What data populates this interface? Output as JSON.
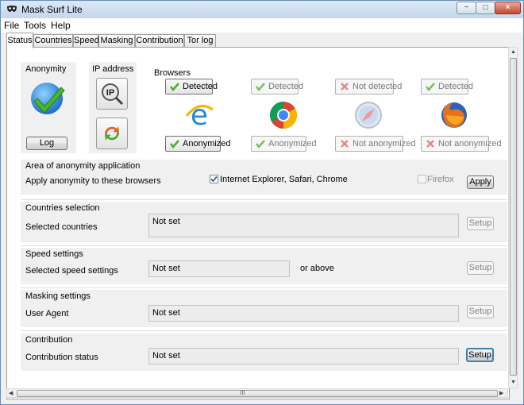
{
  "window": {
    "title": "Mask Surf Lite",
    "controls": {
      "minimize": "−",
      "maximize": "□",
      "close": "×"
    }
  },
  "menu": [
    "File",
    "Tools",
    "Help"
  ],
  "tabs": [
    "Status",
    "Countries",
    "Speed",
    "Masking",
    "Contribution",
    "Tor log"
  ],
  "active_tab": "Status",
  "status": {
    "anonymity": {
      "label": "Anonymity",
      "log_button": "Log",
      "icon": "check-globe-icon"
    },
    "ip": {
      "label": "IP address",
      "ip_icon_text": "IP",
      "icon": "ip-lookup-icon",
      "refresh_icon": "refresh-arrows-icon"
    },
    "browsers": {
      "label": "Browsers",
      "items": [
        {
          "name": "internet-explorer",
          "icon": "ie-icon",
          "detected": "Detected",
          "anonymized": "Anonymized",
          "detected_ok": true,
          "anonymized_ok": true,
          "enabled": true
        },
        {
          "name": "chrome",
          "icon": "chrome-icon",
          "detected": "Detected",
          "anonymized": "Anonymized",
          "detected_ok": true,
          "anonymized_ok": true,
          "enabled": false
        },
        {
          "name": "safari",
          "icon": "safari-icon",
          "detected": "Not detected",
          "anonymized": "Not anonymized",
          "detected_ok": false,
          "anonymized_ok": false,
          "enabled": false
        },
        {
          "name": "firefox",
          "icon": "firefox-icon",
          "detected": "Detected",
          "anonymized": "Not anonymized",
          "detected_ok": true,
          "anonymized_ok": false,
          "enabled": false
        }
      ]
    }
  },
  "area": {
    "title": "Area of anonymity application",
    "row_label": "Apply anonymity to these browsers",
    "checkbox_main": {
      "label": "Internet Explorer, Safari, Chrome",
      "checked": true
    },
    "checkbox_firefox": {
      "label": "Firefox",
      "checked": false,
      "enabled": false
    },
    "apply_button": "Apply"
  },
  "countries": {
    "title": "Countries selection",
    "row_label": "Selected countries",
    "value": "Not set",
    "setup": "Setup"
  },
  "speed": {
    "title": "Speed settings",
    "row_label": "Selected speed settings",
    "value": "Not set",
    "suffix": "or above",
    "setup": "Setup"
  },
  "masking": {
    "title": "Masking settings",
    "row_label": "User Agent",
    "value": "Not set",
    "setup": "Setup"
  },
  "contribution": {
    "title": "Contribution",
    "row_label": "Contribution status",
    "value": "Not set",
    "setup": "Setup"
  },
  "scrollbars": {
    "h_grip": "III"
  },
  "colors": {
    "accent": "#3c7fb1",
    "check_green": "#4cae2a",
    "cross_red": "#d9534f"
  }
}
